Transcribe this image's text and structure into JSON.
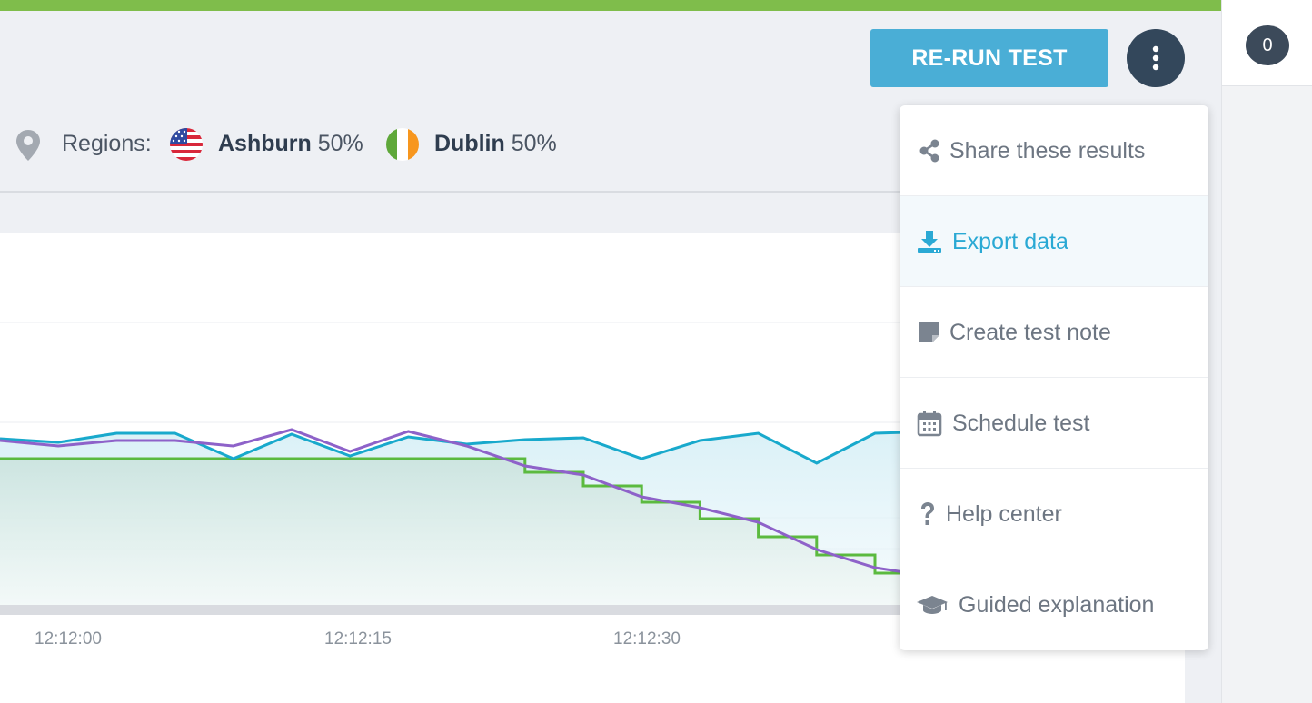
{
  "colors": {
    "accent": "#4aaed6",
    "brand_bar": "#7fbd4b",
    "series_blue": "#18a9cc",
    "series_purple": "#8e62c9",
    "series_green": "#5bba3f",
    "menu_active": "#2aa9d4"
  },
  "header": {
    "rerun_label": "RE-RUN TEST",
    "more_icon": "kebab-vertical-icon",
    "counter_badge": "0"
  },
  "regions": {
    "label": "Regions:",
    "items": [
      {
        "city": "Ashburn",
        "percent": "50%",
        "flag_icon": "us-flag-icon"
      },
      {
        "city": "Dublin",
        "percent": "50%",
        "flag_icon": "ireland-flag-icon"
      }
    ]
  },
  "menu": {
    "items": [
      {
        "label": "Share these results",
        "icon": "share-icon",
        "active": false
      },
      {
        "label": "Export data",
        "icon": "download-icon",
        "active": true
      },
      {
        "label": "Create test note",
        "icon": "note-icon",
        "active": false
      },
      {
        "label": "Schedule test",
        "icon": "calendar-icon",
        "active": false
      },
      {
        "label": "Help center",
        "icon": "question-icon",
        "active": false
      },
      {
        "label": "Guided explanation",
        "icon": "graduation-cap-icon",
        "active": false
      }
    ]
  },
  "chart_data": {
    "type": "line",
    "x_tick_labels": [
      "12:12:00",
      "12:12:15",
      "12:12:30"
    ],
    "grid": true,
    "series": [
      {
        "color": "#18a9cc",
        "values": [
          0.52,
          0.48,
          0.58,
          0.58,
          0.3,
          0.57,
          0.33,
          0.54,
          0.46,
          0.51,
          0.53,
          0.3,
          0.5,
          0.58,
          0.25,
          0.58,
          0.6
        ]
      },
      {
        "color": "#8e62c9",
        "values": [
          0.5,
          0.44,
          0.5,
          0.5,
          0.44,
          0.62,
          0.38,
          0.6,
          0.44,
          0.22,
          0.12,
          -0.12,
          -0.24,
          -0.4,
          -0.7,
          -0.9,
          -1.0
        ]
      },
      {
        "color": "#5bba3f",
        "style": "step",
        "values": [
          0.3,
          0.3,
          0.3,
          0.3,
          0.3,
          0.3,
          0.3,
          0.3,
          0.3,
          0.15,
          0.0,
          -0.18,
          -0.36,
          -0.56,
          -0.76,
          -0.96,
          -0.98
        ]
      }
    ]
  }
}
